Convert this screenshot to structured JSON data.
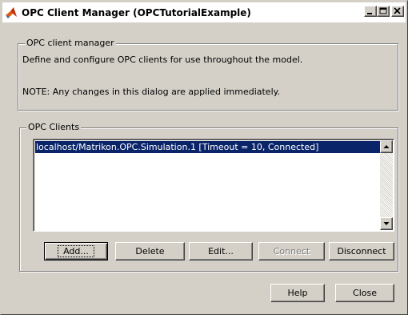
{
  "window": {
    "title": "OPC Client Manager (OPCTutorialExample)",
    "icon": "matlab-icon",
    "controls": [
      "minimize-icon",
      "maximize-icon",
      "close-icon"
    ]
  },
  "manager_group": {
    "legend": "OPC client manager",
    "description": "Define and configure OPC clients for use throughout the model.",
    "note": "NOTE: Any changes in this dialog are applied immediately."
  },
  "clients_group": {
    "legend": "OPC Clients",
    "items": [
      {
        "label": "localhost/Matrikon.OPC.Simulation.1 [Timeout = 10, Connected]",
        "selected": true
      }
    ],
    "scrollbar_icons": [
      "arrow-up-icon",
      "arrow-down-icon"
    ]
  },
  "actions": {
    "add": "Add...",
    "delete": "Delete",
    "edit": "Edit...",
    "connect": "Connect",
    "disconnect": "Disconnect"
  },
  "footer": {
    "help": "Help",
    "close": "Close"
  },
  "colors": {
    "face": "#d4d0c8",
    "selection": "#0a246a",
    "disabled_text": "#808080"
  }
}
